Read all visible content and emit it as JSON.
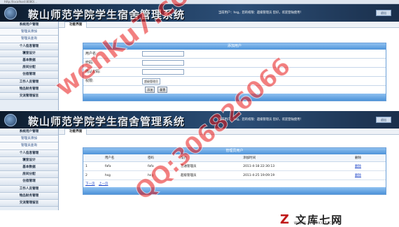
{
  "app": {
    "title": "鞍山师范学院学生宿舍管理系统",
    "url_text": "http://localhost:8080/...",
    "user_info": "当前用户：hsg，您的权限：超级管理员 您好，欢迎登陆使用！",
    "exit_label": "退出"
  },
  "sidebar": {
    "items": [
      {
        "label": "系统用户管理",
        "sub": false
      },
      {
        "label": "管理员添加",
        "sub": true
      },
      {
        "label": "管理员查询",
        "sub": true
      },
      {
        "label": "个人信息管理",
        "sub": false
      },
      {
        "label": "寝室设计",
        "sub": false
      },
      {
        "label": "基本数据",
        "sub": false
      },
      {
        "label": "房间分配",
        "sub": false
      },
      {
        "label": "住宿管理",
        "sub": false
      },
      {
        "label": "工作人员管理",
        "sub": false
      },
      {
        "label": "物品财务管理",
        "sub": false
      },
      {
        "label": "交流管理留言",
        "sub": false
      }
    ]
  },
  "tab": {
    "label": "功能界面"
  },
  "add_form": {
    "header": "添加用户",
    "fields": [
      {
        "label": "用户名:"
      },
      {
        "label": "密码:"
      },
      {
        "label": "确认密码:"
      }
    ],
    "role_label": "权限:",
    "role_value": "超级管理员",
    "submit_label": "添加",
    "reset_label": "重置"
  },
  "user_list": {
    "header": "管理员用户",
    "columns": [
      "",
      "用户名",
      "密码",
      "角色",
      "添加时间",
      "删除"
    ],
    "rows": [
      [
        "1",
        "fafa",
        "fafa",
        "普通管理员",
        "2011-4-18 22:30:13",
        "删除"
      ],
      [
        "2",
        "hsg",
        "hsg",
        "超级管理员",
        "2011-4-25 19:09:19",
        "删除"
      ]
    ],
    "prev_label": "下一页",
    "next_label": "上一页"
  },
  "watermarks": {
    "site": "wenku7.com",
    "qq": "QQ:306826066"
  },
  "footer_logo": {
    "mark": "Z",
    "text": "文库七网",
    "url": "WWW.WENKU7.COM"
  },
  "colors": {
    "banner": "#1d3a5c",
    "panel_header": "#4d93d9",
    "watermark": "#e81616",
    "link": "#1f46c8"
  }
}
